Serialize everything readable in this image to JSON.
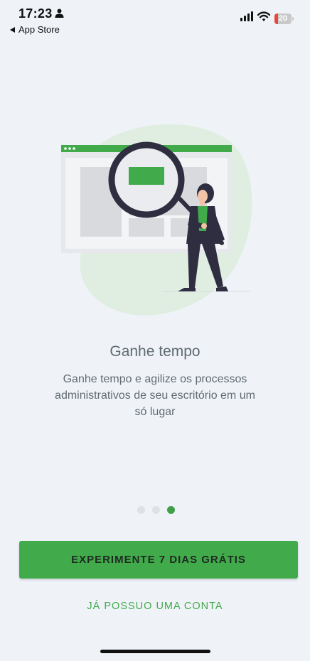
{
  "status_bar": {
    "time": "17:23",
    "back_label": "App Store",
    "battery_level": "20",
    "battery_fraction": 0.2,
    "icons": [
      "person-icon",
      "signal-icon",
      "wifi-icon",
      "battery-icon"
    ]
  },
  "onboarding": {
    "title": "Ganhe tempo",
    "description": "Ganhe tempo e agilize os processos administrativos de seu escritório em um só lugar",
    "page_count": 3,
    "active_page": 3
  },
  "actions": {
    "primary_label": "EXPERIMENTE 7 DIAS GRÁTIS",
    "secondary_label": "JÁ POSSUO UMA CONTA"
  },
  "colors": {
    "accent": "#41ab4b",
    "background": "#eff3f8",
    "text_muted": "#5f6b6f",
    "dot_inactive": "#dde1e4",
    "battery_low": "#e5483c"
  }
}
